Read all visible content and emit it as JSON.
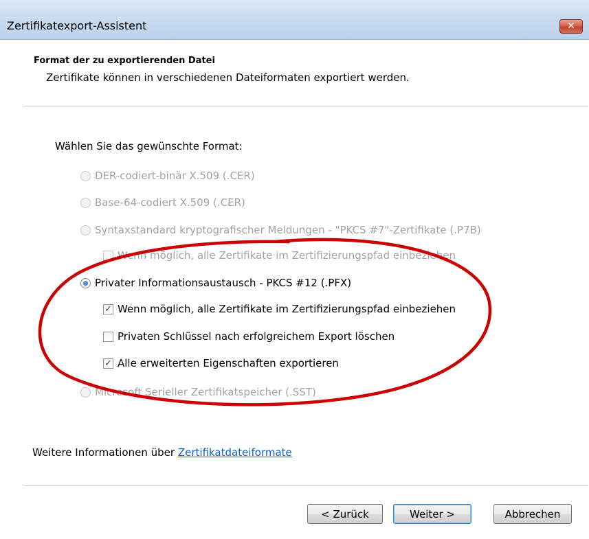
{
  "window": {
    "title": "Zertifikatexport-Assistent",
    "close_glyph": "✕"
  },
  "header": {
    "heading": "Format der zu exportierenden Datei",
    "description": "Zertifikate können in verschiedenen Dateiformaten exportiert werden."
  },
  "format": {
    "prompt": "Wählen Sie das gewünschte Format:",
    "options": [
      {
        "label": "DER-codiert-binär X.509 (.CER)",
        "checked": false,
        "enabled": false
      },
      {
        "label": "Base-64-codiert X.509 (.CER)",
        "checked": false,
        "enabled": false
      },
      {
        "label": "Syntaxstandard kryptografischer Meldungen - \"PKCS #7\"-Zertifikate (.P7B)",
        "checked": false,
        "enabled": false
      },
      {
        "label": "Privater Informationsaustausch - PKCS #12 (.PFX)",
        "checked": true,
        "enabled": true
      },
      {
        "label": "Microsoft Serieller Zertifikatspeicher (.SST)",
        "checked": false,
        "enabled": false
      }
    ],
    "p7b_checkbox": {
      "label": "Wenn möglich, alle Zertifikate im Zertifizierungspfad einbeziehen",
      "checked": false,
      "enabled": false
    },
    "pfx_checkboxes": [
      {
        "label": "Wenn möglich, alle Zertifikate im Zertifizierungspfad einbeziehen",
        "checked": true
      },
      {
        "label": "Privaten Schlüssel nach erfolgreichem Export löschen",
        "checked": false
      },
      {
        "label": "Alle erweiterten Eigenschaften exportieren",
        "checked": true
      }
    ],
    "check_glyph": "✓"
  },
  "info": {
    "text": "Weitere Informationen über",
    "link": "Zertifikatdateiformate"
  },
  "buttons": {
    "back": "< Zurück",
    "next": "Weiter >",
    "cancel": "Abbrechen"
  },
  "colors": {
    "annotation_ellipse": "#cc0000",
    "link": "#0b5cd6",
    "disabled_text": "#a2a2a2"
  }
}
